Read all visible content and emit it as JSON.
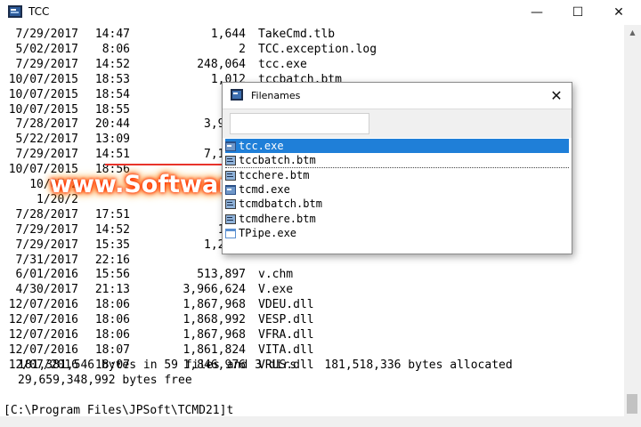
{
  "window": {
    "title": "TCC",
    "minimize_glyph": "—",
    "maximize_glyph": "☐",
    "close_glyph": "✕"
  },
  "listing": [
    {
      "date": "7/29/2017",
      "time": "14:47",
      "size": "1,644",
      "name": "TakeCmd.tlb"
    },
    {
      "date": "5/02/2017",
      "time": "8:06",
      "size": "2",
      "name": "TCC.exception.log"
    },
    {
      "date": "7/29/2017",
      "time": "14:52",
      "size": "248,064",
      "name": "tcc.exe"
    },
    {
      "date": "10/07/2015",
      "time": "18:53",
      "size": "1,012",
      "name": "tccbatch.btm"
    },
    {
      "date": "10/07/2015",
      "time": "18:54",
      "size": "1,",
      "name": ""
    },
    {
      "date": "10/07/2015",
      "time": "18:55",
      "size": "1,",
      "name": ""
    },
    {
      "date": "7/28/2017",
      "time": "20:44",
      "size": "3,954,",
      "name": ""
    },
    {
      "date": "5/22/2017",
      "time": "13:09",
      "size": "",
      "name": ""
    },
    {
      "date": "7/29/2017",
      "time": "14:51",
      "size": "7,103,",
      "name": ""
    },
    {
      "date": "10/07/2015",
      "time": "18:56",
      "size": "1,",
      "name": ""
    },
    {
      "date": "10/07/2",
      "time": "",
      "size": "",
      "name": ""
    },
    {
      "date": "1/20/2",
      "time": "",
      "size": "",
      "name": ""
    },
    {
      "date": "7/28/2017",
      "time": "17:51",
      "size": "1",
      "name": ""
    },
    {
      "date": "7/29/2017",
      "time": "14:52",
      "size": "166,",
      "name": ""
    },
    {
      "date": "7/29/2017",
      "time": "15:35",
      "size": "1,291,",
      "name": ""
    },
    {
      "date": "7/31/2017",
      "time": "22:16",
      "size": "",
      "name": ""
    },
    {
      "date": "6/01/2016",
      "time": "15:56",
      "size": "513,897",
      "name": "v.chm"
    },
    {
      "date": "4/30/2017",
      "time": "21:13",
      "size": "3,966,624",
      "name": "V.exe"
    },
    {
      "date": "12/07/2016",
      "time": "18:06",
      "size": "1,867,968",
      "name": "VDEU.dll"
    },
    {
      "date": "12/07/2016",
      "time": "18:06",
      "size": "1,868,992",
      "name": "VESP.dll"
    },
    {
      "date": "12/07/2016",
      "time": "18:06",
      "size": "1,867,968",
      "name": "VFRA.dll"
    },
    {
      "date": "12/07/2016",
      "time": "18:07",
      "size": "1,861,824",
      "name": "VITA.dll"
    },
    {
      "date": "12/07/2016",
      "time": "18:07",
      "size": "1,846,976",
      "name": "VRUS.dll"
    }
  ],
  "summary": {
    "line1": "181,381,546 bytes in 59 files and 3 dirs    181,518,336 bytes allocated",
    "line2": "29,659,348,992 bytes free"
  },
  "prompt": "[C:\\Program Files\\JPSoft\\TCMD21]t",
  "popup": {
    "title": "Filenames",
    "close_glyph": "✕",
    "input_value": "",
    "items": [
      {
        "label": "tcc.exe",
        "icon": "exe-icon",
        "selected": true
      },
      {
        "label": "tccbatch.btm",
        "icon": "batch-file-icon",
        "selected": false
      },
      {
        "label": "tcchere.btm",
        "icon": "batch-file-icon",
        "selected": false
      },
      {
        "label": "tcmd.exe",
        "icon": "exe-icon",
        "selected": false
      },
      {
        "label": "tcmdbatch.btm",
        "icon": "batch-file-icon",
        "selected": false
      },
      {
        "label": "tcmdhere.btm",
        "icon": "batch-file-icon",
        "selected": false
      },
      {
        "label": "TPipe.exe",
        "icon": "app-window-icon",
        "selected": false
      }
    ]
  },
  "watermark": "www.SoftwaresGate.com",
  "colors": {
    "selection": "#1f7fd8",
    "watermark_glow": "#ff2a00"
  }
}
